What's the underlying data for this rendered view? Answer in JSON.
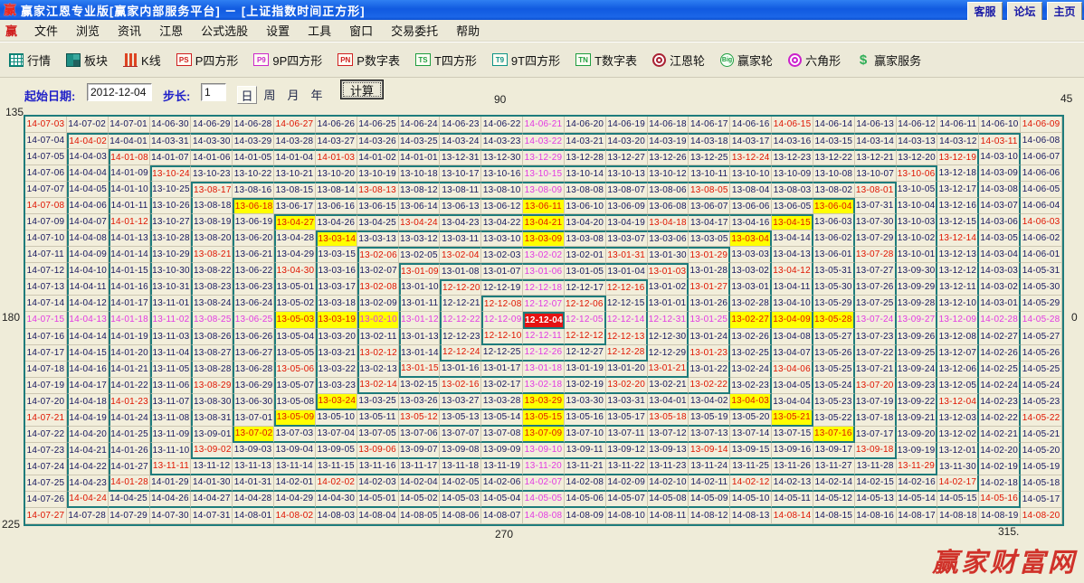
{
  "title_bar": {
    "app_icon": "赢",
    "title": "赢家江恩专业版[赢家内部服务平台] － [上证指数时间正方形]",
    "buttons": [
      {
        "label": "客服"
      },
      {
        "label": "论坛"
      },
      {
        "label": "主页"
      }
    ]
  },
  "menu_bar": {
    "brand": "赢",
    "items": [
      "文件",
      "浏览",
      "资讯",
      "江恩",
      "公式选股",
      "设置",
      "工具",
      "窗口",
      "交易委托",
      "帮助"
    ]
  },
  "toolbar": {
    "items": [
      {
        "icon": "market-grid-icon",
        "style": "ic-grid",
        "badge": "",
        "label": "行情"
      },
      {
        "icon": "blocks-icon",
        "style": "ic-blocks",
        "badge": "",
        "label": "板块"
      },
      {
        "icon": "kline-icon",
        "style": "ic-candle",
        "badge": "",
        "label": "K线"
      },
      {
        "icon": "p-square-icon",
        "style": "ic-box bx-red",
        "badge": "PS",
        "label": "P四方形"
      },
      {
        "icon": "9p-square-icon",
        "style": "ic-box bx-mag",
        "badge": "P9",
        "label": "9P四方形"
      },
      {
        "icon": "p-table-icon",
        "style": "ic-box bx-red",
        "badge": "PN",
        "label": "P数字表"
      },
      {
        "icon": "t-square-icon",
        "style": "ic-box bx-grn",
        "badge": "TS",
        "label": "T四方形"
      },
      {
        "icon": "9t-square-icon",
        "style": "ic-box bx-teal",
        "badge": "T9",
        "label": "9T四方形"
      },
      {
        "icon": "t-table-icon",
        "style": "ic-box bx-grn",
        "badge": "TN",
        "label": "T数字表"
      },
      {
        "icon": "gann-wheel-icon",
        "style": "ic-ring",
        "badge": "",
        "label": "江恩轮"
      },
      {
        "icon": "winner-wheel-icon",
        "style": "ic-big",
        "badge": "Big",
        "label": "赢家轮"
      },
      {
        "icon": "hexagon-icon",
        "style": "ic-ring mag",
        "badge": "",
        "label": "六角形"
      },
      {
        "icon": "winner-service-icon",
        "style": "ic-dollar",
        "badge": "$",
        "label": "赢家服务"
      }
    ]
  },
  "controls": {
    "start_label": "起始日期:",
    "start_value": "2012-12-04",
    "step_label": "步长:",
    "step_value": "1",
    "periods": [
      "日",
      "周",
      "月",
      "年"
    ],
    "selected_period": "日",
    "calc_label": "计算"
  },
  "square": {
    "start_date": "2012-12-04",
    "step_days": 1,
    "rows": 25,
    "cols": 25,
    "center": [
      13,
      13
    ],
    "center_date_label": "12-12-04",
    "last_date_label": "14-08-20",
    "angle_labels": {
      "tl": "135",
      "top": "90",
      "tr": "45",
      "left": "180",
      "right": "0",
      "bl": "225",
      "bottom": "270",
      "br": "315."
    },
    "highlights": {
      "red": [
        [
          1,
          1
        ],
        [
          1,
          7
        ],
        [
          1,
          19
        ],
        [
          1,
          25
        ],
        [
          2,
          2
        ],
        [
          2,
          24
        ],
        [
          3,
          3
        ],
        [
          3,
          8
        ],
        [
          3,
          18
        ],
        [
          3,
          23
        ],
        [
          4,
          4
        ],
        [
          4,
          22
        ],
        [
          5,
          5
        ],
        [
          5,
          9
        ],
        [
          5,
          17
        ],
        [
          5,
          21
        ],
        [
          6,
          1
        ],
        [
          7,
          3
        ],
        [
          7,
          10
        ],
        [
          7,
          16
        ],
        [
          7,
          25
        ],
        [
          8,
          23
        ],
        [
          9,
          5
        ],
        [
          9,
          9
        ],
        [
          9,
          11
        ],
        [
          9,
          15
        ],
        [
          9,
          17
        ],
        [
          9,
          21
        ],
        [
          10,
          7
        ],
        [
          10,
          10
        ],
        [
          10,
          16
        ],
        [
          10,
          19
        ],
        [
          11,
          9
        ],
        [
          11,
          11
        ],
        [
          11,
          15
        ],
        [
          11,
          17
        ],
        [
          12,
          12
        ],
        [
          12,
          14
        ],
        [
          14,
          12
        ],
        [
          14,
          14
        ],
        [
          14,
          15
        ],
        [
          15,
          9
        ],
        [
          15,
          11
        ],
        [
          15,
          15
        ],
        [
          15,
          17
        ],
        [
          16,
          7
        ],
        [
          16,
          10
        ],
        [
          16,
          16
        ],
        [
          16,
          19
        ],
        [
          17,
          5
        ],
        [
          17,
          9
        ],
        [
          17,
          11
        ],
        [
          17,
          15
        ],
        [
          17,
          17
        ],
        [
          17,
          21
        ],
        [
          18,
          3
        ],
        [
          18,
          23
        ],
        [
          19,
          1
        ],
        [
          19,
          10
        ],
        [
          19,
          16
        ],
        [
          19,
          25
        ],
        [
          21,
          5
        ],
        [
          21,
          9
        ],
        [
          21,
          17
        ],
        [
          21,
          21
        ],
        [
          22,
          4
        ],
        [
          22,
          22
        ],
        [
          23,
          3
        ],
        [
          23,
          8
        ],
        [
          23,
          18
        ],
        [
          23,
          23
        ],
        [
          24,
          2
        ],
        [
          24,
          24
        ],
        [
          25,
          1
        ],
        [
          25,
          7
        ],
        [
          25,
          19
        ],
        [
          25,
          25
        ]
      ],
      "magenta": [
        [
          1,
          13
        ],
        [
          2,
          13
        ],
        [
          3,
          13
        ],
        [
          4,
          13
        ],
        [
          5,
          13
        ],
        [
          9,
          13
        ],
        [
          10,
          13
        ],
        [
          11,
          13
        ],
        [
          12,
          13
        ],
        [
          14,
          13
        ],
        [
          15,
          13
        ],
        [
          16,
          13
        ],
        [
          17,
          13
        ],
        [
          21,
          13
        ],
        [
          22,
          13
        ],
        [
          23,
          13
        ],
        [
          24,
          13
        ],
        [
          25,
          13
        ],
        [
          13,
          1
        ],
        [
          13,
          2
        ],
        [
          13,
          3
        ],
        [
          13,
          4
        ],
        [
          13,
          5
        ],
        [
          13,
          6
        ],
        [
          13,
          10
        ],
        [
          13,
          11
        ],
        [
          13,
          12
        ],
        [
          13,
          14
        ],
        [
          13,
          15
        ],
        [
          13,
          16
        ],
        [
          13,
          17
        ],
        [
          13,
          21
        ],
        [
          13,
          22
        ],
        [
          13,
          23
        ],
        [
          13,
          24
        ],
        [
          13,
          25
        ]
      ],
      "yellow_red": [
        [
          6,
          6
        ],
        [
          6,
          13
        ],
        [
          6,
          20
        ],
        [
          7,
          7
        ],
        [
          7,
          13
        ],
        [
          7,
          19
        ],
        [
          8,
          8
        ],
        [
          8,
          13
        ],
        [
          8,
          18
        ],
        [
          13,
          7
        ],
        [
          13,
          8
        ],
        [
          13,
          18
        ],
        [
          13,
          19
        ],
        [
          13,
          20
        ],
        [
          18,
          8
        ],
        [
          18,
          13
        ],
        [
          18,
          18
        ],
        [
          19,
          7
        ],
        [
          19,
          13
        ],
        [
          19,
          19
        ],
        [
          20,
          6
        ],
        [
          20,
          13
        ],
        [
          20,
          20
        ]
      ],
      "yellow_magenta": [
        [
          13,
          9
        ]
      ],
      "center_cell": [
        [
          13,
          13
        ]
      ]
    }
  },
  "watermark": "赢家财富网",
  "colors": {
    "title_blue": "#115ae0",
    "chrome_beige": "#ece9d8",
    "cell_bg": "#f2eedb",
    "ring_teal": "#1e7c7c",
    "text_navy": "#16165e",
    "highlight_red": "#df1400",
    "highlight_magenta": "#e23ae2",
    "highlight_yellow": "#ffff00",
    "center_red": "#e51212",
    "watermark_red": "#d0322a"
  }
}
